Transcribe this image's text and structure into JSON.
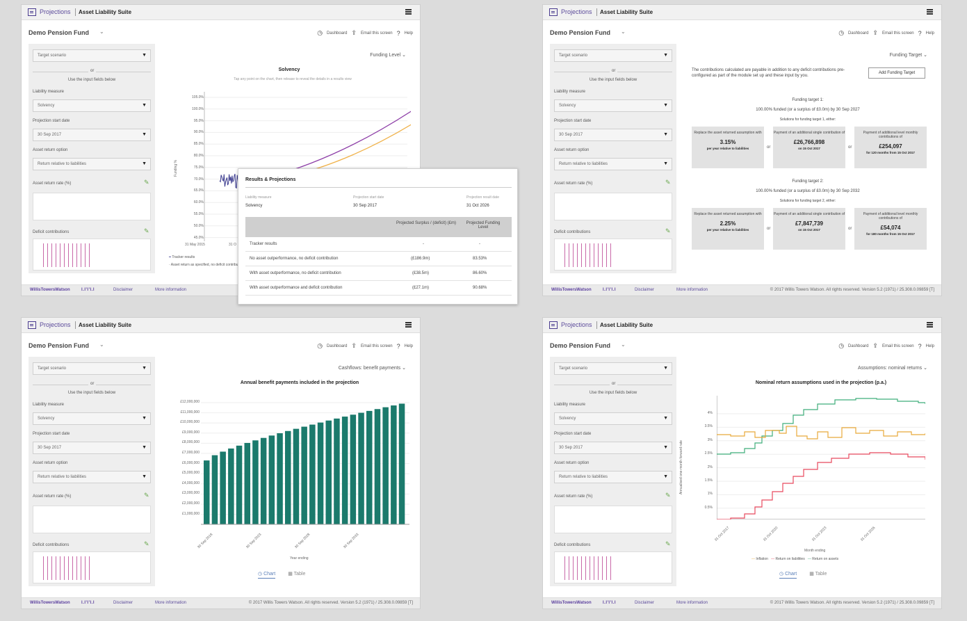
{
  "common": {
    "app_name": "Projections",
    "suite_name": "Asset Liability Suite",
    "fund_name": "Demo Pension Fund",
    "links": {
      "dashboard": "Dashboard",
      "email": "Email this screen",
      "help": "Help"
    },
    "sidebar": {
      "target_scenario": "Target scenario",
      "or": "or",
      "use_input": "Use the input fields below",
      "liability_label": "Liability measure",
      "liability_value": "Solvency",
      "start_label": "Projection start date",
      "start_value": "30 Sep 2017",
      "asset_opt_label": "Asset return option",
      "asset_opt_value": "Return relative to liabilities",
      "asset_rate_label": "Asset return rate (%)",
      "deficit_label": "Deficit contributions"
    },
    "footer": {
      "brand": "WillisTowersWatson",
      "brand_mark": "I.I'I'I.I",
      "disclaimer": "Disclaimer",
      "more": "More information",
      "copyright": "© 2017 Willis Towers Watson. All rights reserved. Version 5.2 (1971) / 25.308.0.09859 [T]"
    }
  },
  "panel1": {
    "view": "Funding Level",
    "chart_title": "Solvency",
    "chart_subtitle": "Tap any point on the chart, then release to reveal the details in a results view",
    "ylabel": "Funding %",
    "y_ticks": [
      "105.0%",
      "100.0%",
      "95.0%",
      "90.0%",
      "85.0%",
      "80.0%",
      "75.0%",
      "70.0%",
      "65.0%",
      "60.0%",
      "55.0%",
      "50.0%",
      "45.0%"
    ],
    "x_ticks": [
      "31 May 2015",
      "31 O"
    ],
    "legend": [
      "Tracker results",
      "Asset return as specified, no deficit contribution"
    ],
    "popup": {
      "title": "Results & Projections",
      "headers": [
        "Liability measure",
        "Projection start date",
        "Projection result date"
      ],
      "values": [
        "Solvency",
        "30 Sep 2017",
        "31 Oct 2026"
      ],
      "table_head": [
        "Projected Surplus / (deficit) (£m)",
        "Projected Funding Level"
      ],
      "rows": [
        {
          "label": "Tracker results",
          "surplus": "-",
          "level": "-"
        },
        {
          "label": "No asset outperformance, no deficit contribution",
          "surplus": "(£186.9m)",
          "level": "83.53%"
        },
        {
          "label": "With asset outperformance, no deficit contribution",
          "surplus": "(£38.5m)",
          "level": "86.60%"
        },
        {
          "label": "With asset outperformance and deficit contribution",
          "surplus": "(£27.1m)",
          "level": "90.68%"
        }
      ]
    }
  },
  "panel2": {
    "view": "Funding Target",
    "intro": "The contributions calculated are payable in addition to any deficit contributions pre-configured as part of the module set up and these input by you.",
    "add_button": "Add Funding Target",
    "targets": [
      {
        "title": "Funding target 1:",
        "desc": "100.00% funded (or a surplus of £0.0m) by 30 Sep 2027",
        "solutions": "Solutions for funding target 1, either:",
        "cards": [
          {
            "text": "Replace the asset returned assumption with",
            "big": "3.15%",
            "small": "per year relative to liabilities"
          },
          {
            "text": "Payment of an additional single contribution of",
            "big": "£26,766,898",
            "small": "on 15 Oct 2017"
          },
          {
            "text": "Payment of additional level monthly contributions of",
            "big": "£254,097",
            "small": "for 120 months from 15 Oct 2017"
          }
        ]
      },
      {
        "title": "Funding target 2:",
        "desc": "100.00% funded (or a surplus of £0.0m) by 30 Sep 2032",
        "solutions": "Solutions for funding target 2, either:",
        "cards": [
          {
            "text": "Replace the asset returned assumption with",
            "big": "2.25%",
            "small": "per year relative to liabilities"
          },
          {
            "text": "Payment of an additional single contribution of",
            "big": "£7,847,739",
            "small": "on 15 Oct 2017"
          },
          {
            "text": "Payment of additional level monthly contributions of",
            "big": "£54,074",
            "small": "for 180 months from 15 Oct 2017"
          }
        ]
      }
    ],
    "or": "or"
  },
  "panel3": {
    "view": "Cashflows: benefit payments",
    "chart_title": "Annual benefit payments included in the projection",
    "xlabel": "Year ending",
    "y_ticks": [
      "£12,000,000",
      "£11,000,000",
      "£10,000,000",
      "£9,000,000",
      "£8,000,000",
      "£7,000,000",
      "£6,000,000",
      "£5,000,000",
      "£4,000,000",
      "£3,000,000",
      "£2,000,000",
      "£1,000,000"
    ],
    "x_ticks": [
      "30 Sep 2018",
      "30 Sep 2023",
      "30 Sep 2028",
      "30 Sep 2033"
    ],
    "tab_chart": "Chart",
    "tab_table": "Table",
    "bar_color": "#1b7a6c"
  },
  "panel4": {
    "view": "Assumptions: nominal returns",
    "chart_title": "Nominal return assumptions used in the projection (p.a.)",
    "ylabel": "Annualised one-month forward rate",
    "xlabel": "Month ending",
    "y_ticks": [
      "4%",
      "3.5%",
      "3%",
      "2.5%",
      "2%",
      "1.5%",
      "1%",
      "0.5%"
    ],
    "x_ticks": [
      "31 Oct 2017",
      "31 Oct 2020",
      "31 Oct 2023",
      "31 Oct 2026"
    ],
    "legend": [
      "Inflation",
      "Return on liabilities",
      "Return on assets"
    ],
    "tab_chart": "Chart",
    "tab_table": "Table",
    "colors": {
      "inflation": "#e8a93a",
      "liabilities": "#e8495e",
      "assets": "#3fae7a"
    }
  }
}
